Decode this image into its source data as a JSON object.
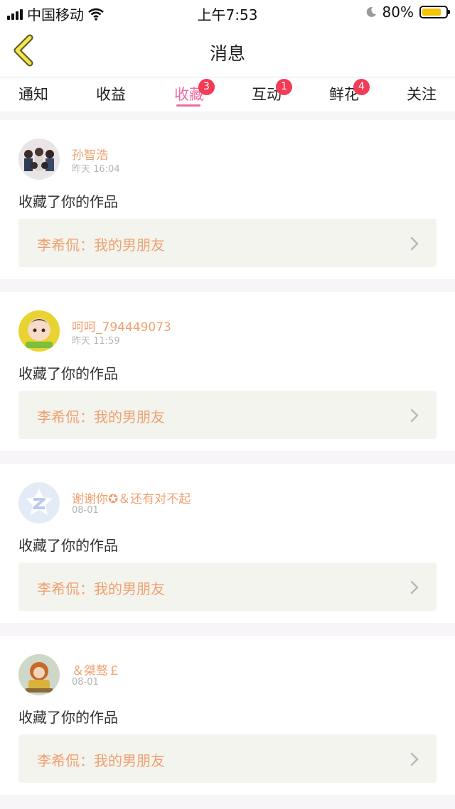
{
  "status_bar": {
    "carrier": "中国移动",
    "time": "上午7:53",
    "battery": "80%",
    "battery_level": 0.8
  },
  "nav": {
    "title": "消息",
    "back_icon": "chevron-left-icon"
  },
  "tabs": [
    {
      "label": "通知"
    },
    {
      "label": "收益"
    },
    {
      "label": "收藏",
      "badge": "3",
      "active": true
    },
    {
      "label": "互动",
      "badge": "1"
    },
    {
      "label": "鲜花",
      "badge": "4"
    },
    {
      "label": "关注"
    }
  ],
  "colors": {
    "accent": "#ef6aa0",
    "badge": "#f23b55",
    "name": "#f0a070",
    "work_bg": "#f3f4ee"
  },
  "items": [
    {
      "username": "孙智浩",
      "time": "昨天 16:04",
      "action": "收藏了你的作品",
      "work": "李希侃：我的男朋友"
    },
    {
      "username": "呵呵_794449073",
      "time": "昨天 11:59",
      "action": "收藏了你的作品",
      "work": "李希侃：我的男朋友"
    },
    {
      "username": "谢谢你✪＆还有对不起",
      "time": "08-01",
      "action": "收藏了你的作品",
      "work": "李希侃：我的男朋友"
    },
    {
      "username": "＆桀骜￡",
      "time": "08-01",
      "action": "收藏了你的作品",
      "work": "李希侃：我的男朋友"
    }
  ]
}
